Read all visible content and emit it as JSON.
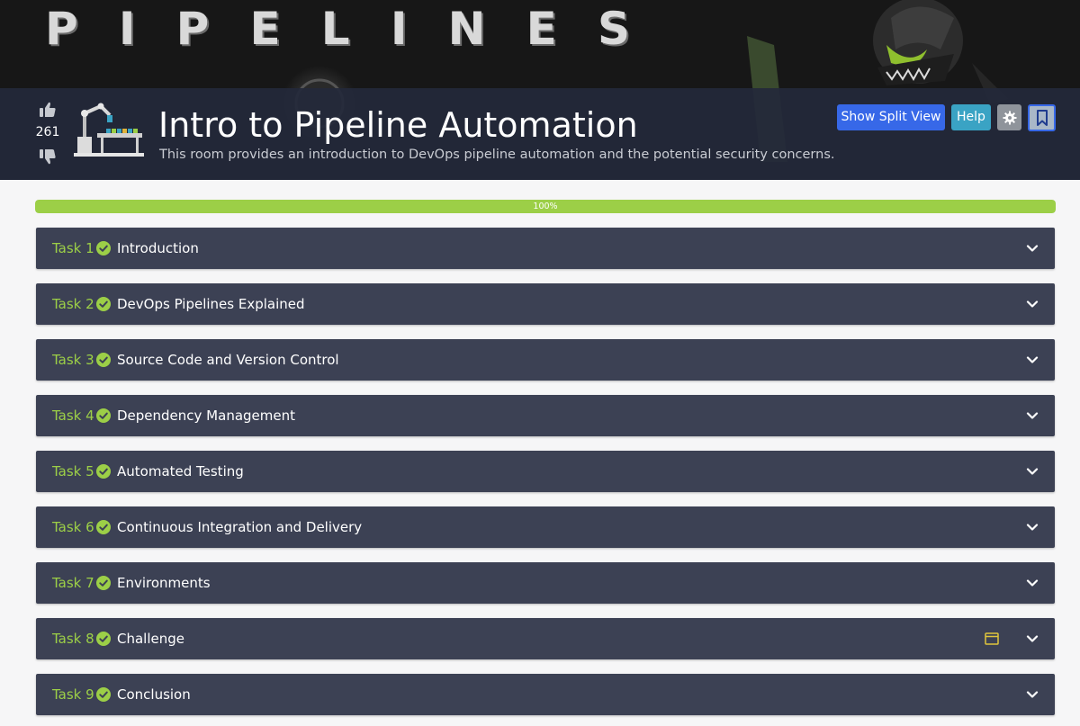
{
  "banner": {
    "word_letters": [
      "P",
      "I",
      "P",
      "E",
      "L",
      "I",
      "N",
      "E",
      "S"
    ]
  },
  "room": {
    "title": "Intro to Pipeline Automation",
    "description": "This room provides an introduction to DevOps pipeline automation and the potential security concerns.",
    "votes": "261"
  },
  "buttons": {
    "split_view": "Show Split View",
    "help": "Help"
  },
  "icons": {
    "upvote": "thumbs-up-icon",
    "downvote": "thumbs-down-icon",
    "settings": "gear-icon",
    "save": "bookmark-icon",
    "complete": "check-circle-icon",
    "expand": "chevron-down-icon",
    "challenge": "flag-icon"
  },
  "progress": {
    "value": 1.0,
    "label": "100%"
  },
  "tasks": [
    {
      "number": "Task 1",
      "title": "Introduction"
    },
    {
      "number": "Task 2",
      "title": "DevOps Pipelines Explained"
    },
    {
      "number": "Task 3",
      "title": "Source Code and Version Control"
    },
    {
      "number": "Task 4",
      "title": "Dependency Management"
    },
    {
      "number": "Task 5",
      "title": "Automated Testing"
    },
    {
      "number": "Task 6",
      "title": "Continuous Integration and Delivery"
    },
    {
      "number": "Task 7",
      "title": "Environments"
    },
    {
      "number": "Task 8",
      "title": "Challenge"
    },
    {
      "number": "Task 9",
      "title": "Conclusion"
    }
  ],
  "colors": {
    "accent_green": "#9ccf47",
    "task_bg": "#3c4154",
    "split_button": "#3768e8",
    "help_button": "#3aa3c4"
  }
}
